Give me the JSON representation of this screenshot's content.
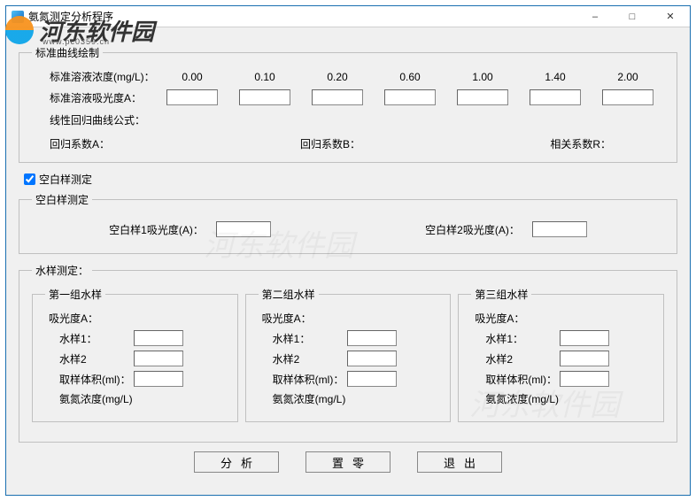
{
  "window": {
    "title": "氨氮测定分析程序",
    "minimize": "–",
    "maximize": "□",
    "close": "✕"
  },
  "watermark": {
    "brand": "河东软件园",
    "url": "www.pc0359.cn"
  },
  "std_curve": {
    "legend": "标准曲线绘制",
    "conc_label": "标准溶液浓度(mg/L)：",
    "conc_values": [
      "0.00",
      "0.10",
      "0.20",
      "0.60",
      "1.00",
      "1.40",
      "2.00"
    ],
    "abs_label": "标准溶液吸光度A：",
    "abs_values": [
      "",
      "",
      "",
      "",
      "",
      "",
      ""
    ],
    "formula_label": "线性回归曲线公式：",
    "coefA_label": "回归系数A：",
    "coefB_label": "回归系数B：",
    "coefR_label": "相关系数R："
  },
  "blank_measure": {
    "checkbox_label": "空白样测定",
    "legend": "空白样测定",
    "blank1_label": "空白样1吸光度(A)：",
    "blank1_value": "",
    "blank2_label": "空白样2吸光度(A)：",
    "blank2_value": ""
  },
  "water_samples": {
    "legend": "水样测定：",
    "groups": [
      {
        "legend": "第一组水样",
        "abs_label": "吸光度A：",
        "s1_label": "水样1：",
        "s1_value": "",
        "s2_label": "水样2",
        "s2_value": "",
        "vol_label": "取样体积(ml)：",
        "vol_value": "",
        "conc_label": "氨氮浓度(mg/L)"
      },
      {
        "legend": "第二组水样",
        "abs_label": "吸光度A：",
        "s1_label": "水样1：",
        "s1_value": "",
        "s2_label": "水样2",
        "s2_value": "",
        "vol_label": "取样体积(ml)：",
        "vol_value": "",
        "conc_label": "氨氮浓度(mg/L)"
      },
      {
        "legend": "第三组水样",
        "abs_label": "吸光度A：",
        "s1_label": "水样1：",
        "s1_value": "",
        "s2_label": "水样2",
        "s2_value": "",
        "vol_label": "取样体积(ml)：",
        "vol_value": "",
        "conc_label": "氨氮浓度(mg/L)"
      }
    ]
  },
  "buttons": {
    "analyze": "分析",
    "reset": "置零",
    "exit": "退出"
  }
}
